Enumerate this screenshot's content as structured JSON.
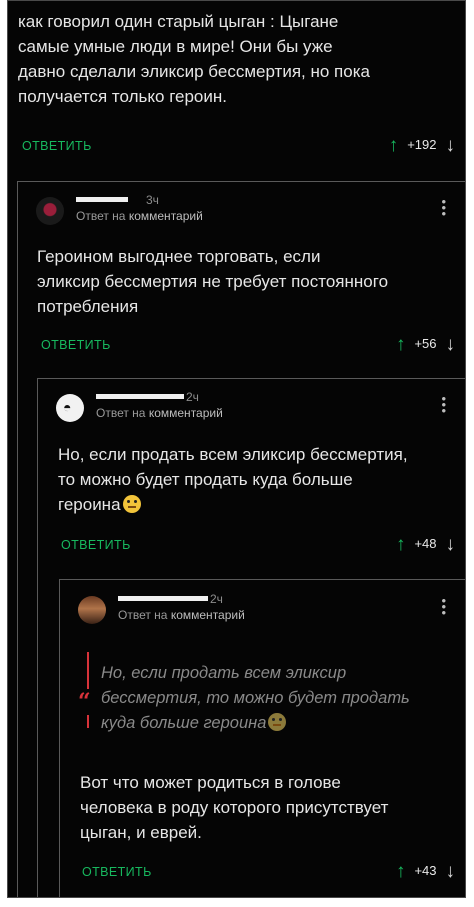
{
  "comments": [
    {
      "text_lines": [
        "как говорил один старый цыган : Цыгане",
        "самые умные люди в мире! Они бы уже",
        "давно сделали эликсир бессмертия, но пока",
        "получается только героин."
      ],
      "reply_label": "ОТВЕТИТЬ",
      "score": "+192"
    },
    {
      "time": "3ч",
      "subtitle_prefix": "Ответ на",
      "subtitle_link": "комментарий",
      "text_lines": [
        "Героином выгоднее торговать, если",
        "эликсир бессмертия не требует постоянного",
        "потребления"
      ],
      "reply_label": "ОТВЕТИТЬ",
      "score": "+56"
    },
    {
      "time": "2ч",
      "subtitle_prefix": "Ответ на",
      "subtitle_link": "комментарий",
      "text_lines": [
        "Но, если продать всем эликсир бессмертия,",
        "то можно будет продать куда больше",
        "героина"
      ],
      "reply_label": "ОТВЕТИТЬ",
      "score": "+48"
    },
    {
      "time": "2ч",
      "subtitle_prefix": "Ответ на",
      "subtitle_link": "комментарий",
      "quote_lines": [
        "Но, если продать всем эликсир",
        "бессмертия, то можно будет продать",
        "куда больше героина"
      ],
      "text_lines": [
        "Вот что может родиться в голове",
        "человека в роду которого присутствует",
        "цыган, и еврей."
      ],
      "reply_label": "ОТВЕТИТЬ",
      "score": "+43"
    }
  ],
  "icons": {
    "upvote": "arrow-up-icon",
    "downvote": "arrow-down-icon",
    "menu": "more-vertical-icon",
    "quote": "quote-icon",
    "emoji": "thinking-face-icon"
  },
  "colors": {
    "background": "#050505",
    "accent": "#17b85e",
    "quote_bar": "#d8333a"
  }
}
